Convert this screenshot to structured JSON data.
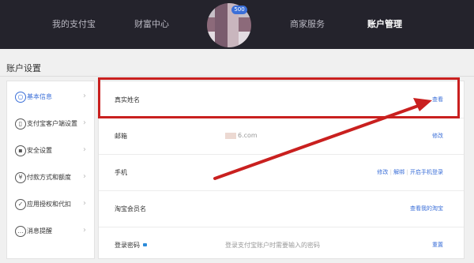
{
  "topnav": {
    "items": [
      "我的支付宝",
      "财富中心",
      "商家服务",
      "账户管理"
    ],
    "avatar_badge": "500"
  },
  "page_title": "账户设置",
  "sidebar": {
    "items": [
      {
        "label": "基本信息",
        "icon": "user-icon"
      },
      {
        "label": "支付宝客户端设置",
        "icon": "mobile-icon"
      },
      {
        "label": "安全设置",
        "icon": "lock-icon"
      },
      {
        "label": "付款方式和额度",
        "icon": "yen-icon"
      },
      {
        "label": "应用授权和代扣",
        "icon": "check-icon"
      },
      {
        "label": "消息提醒",
        "icon": "message-icon"
      }
    ]
  },
  "rows": {
    "real_name": {
      "label": "真实姓名",
      "value": "",
      "action": "查看"
    },
    "email": {
      "label": "邮箱",
      "value": "6.com",
      "action": "修改"
    },
    "phone": {
      "label": "手机",
      "actions": [
        "修改",
        "解绑",
        "开启手机登录"
      ],
      "sep": "|"
    },
    "taobao": {
      "label": "淘宝会员名",
      "action": "查看我的淘宝"
    },
    "password": {
      "label": "登录密码",
      "value": "登录支付宝账户时需要输入的密码",
      "action": "重置"
    }
  },
  "colors": {
    "highlight": "#c9201f",
    "link": "#3b6fd8",
    "topbar": "#24232c"
  }
}
